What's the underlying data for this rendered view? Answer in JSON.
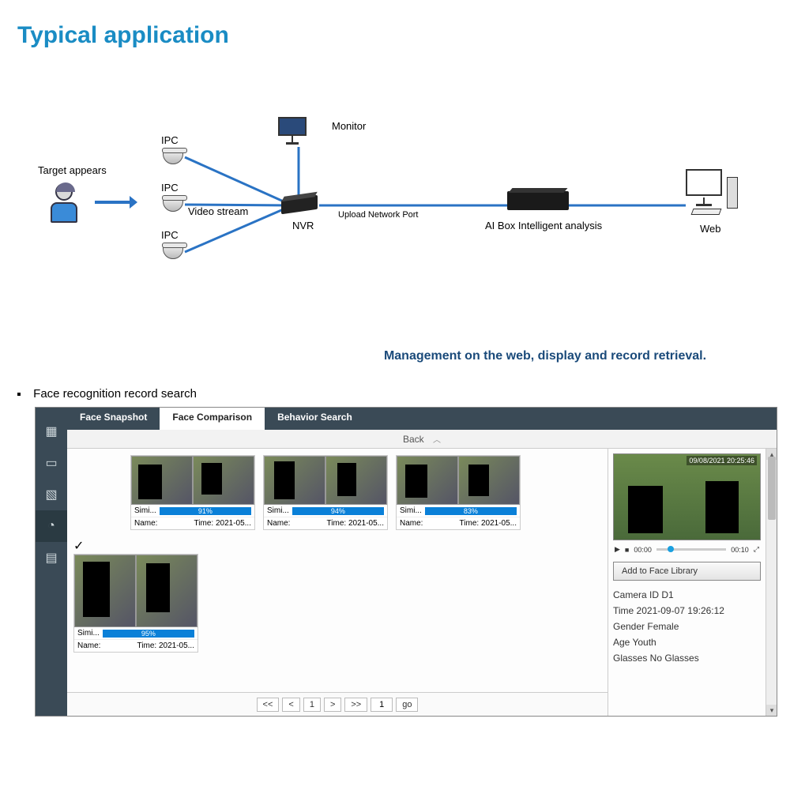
{
  "title": "Typical application",
  "diagram": {
    "target_label": "Target appears",
    "ipc_label": "IPC",
    "video_stream_label": "Video stream",
    "nvr_label": "NVR",
    "monitor_label": "Monitor",
    "upload_label": "Upload Network Port",
    "aibox_label": "AI Box Intelligent analysis",
    "web_label": "Web"
  },
  "subtitle": "Management on the web, display and record retrieval.",
  "bullet": "Face recognition record search",
  "app": {
    "tabs": [
      "Face Snapshot",
      "Face Comparison",
      "Behavior Search"
    ],
    "active_tab_index": 1,
    "back_label": "Back",
    "simi_label": "Simi...",
    "name_label": "Name:",
    "time_label": "Time: 2021-05...",
    "results": [
      {
        "similarity": "91%"
      },
      {
        "similarity": "94%"
      },
      {
        "similarity": "83%"
      },
      {
        "similarity": "95%"
      }
    ],
    "detail": {
      "preview_ts": "09/08/2021 20:25:46",
      "play_start": "00:00",
      "play_end": "00:10",
      "add_button": "Add to Face Library",
      "camera_line": "Camera ID D1",
      "time_line": "Time 2021-09-07 19:26:12",
      "gender_line": "Gender Female",
      "age_line": "Age Youth",
      "glasses_line": "Glasses No Glasses"
    },
    "pager": {
      "first": "<<",
      "prev": "<",
      "page": "1",
      "next": ">",
      "last": ">>",
      "goto": "1",
      "go_label": "go"
    }
  }
}
